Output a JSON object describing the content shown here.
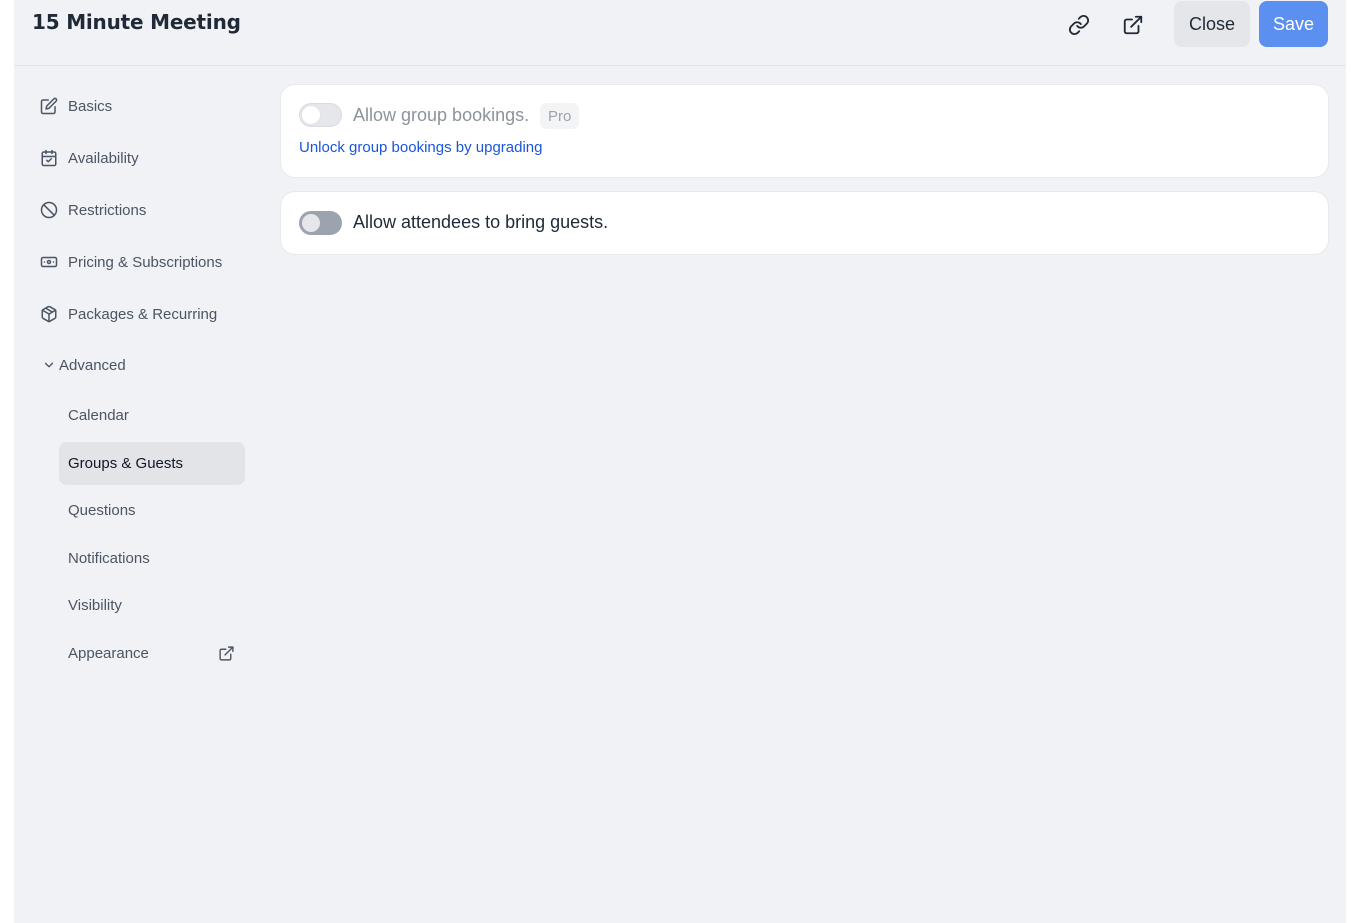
{
  "header": {
    "title": "15 Minute Meeting",
    "close_label": "Close",
    "save_label": "Save"
  },
  "sidebar": {
    "items": [
      {
        "label": "Basics",
        "icon": "edit-icon"
      },
      {
        "label": "Availability",
        "icon": "calendar-check-icon"
      },
      {
        "label": "Restrictions",
        "icon": "ban-icon"
      },
      {
        "label": "Pricing & Subscriptions",
        "icon": "banknote-icon"
      },
      {
        "label": "Packages & Recurring",
        "icon": "package-icon"
      }
    ],
    "advanced": {
      "label": "Advanced",
      "expanded": true,
      "items": [
        {
          "label": "Calendar"
        },
        {
          "label": "Groups & Guests",
          "active": true
        },
        {
          "label": "Questions"
        },
        {
          "label": "Notifications"
        },
        {
          "label": "Visibility"
        },
        {
          "label": "Appearance",
          "icon": "external-link-icon"
        }
      ]
    }
  },
  "main": {
    "group_bookings": {
      "label": "Allow group bookings.",
      "badge": "Pro",
      "enabled": false,
      "disabled": true,
      "link": "Unlock group bookings by upgrading"
    },
    "guests": {
      "label": "Allow attendees to bring guests.",
      "enabled": false
    }
  },
  "colors": {
    "accent": "#5b8ff0",
    "link": "#1a56db",
    "panel_bg": "#f0f2f5"
  }
}
